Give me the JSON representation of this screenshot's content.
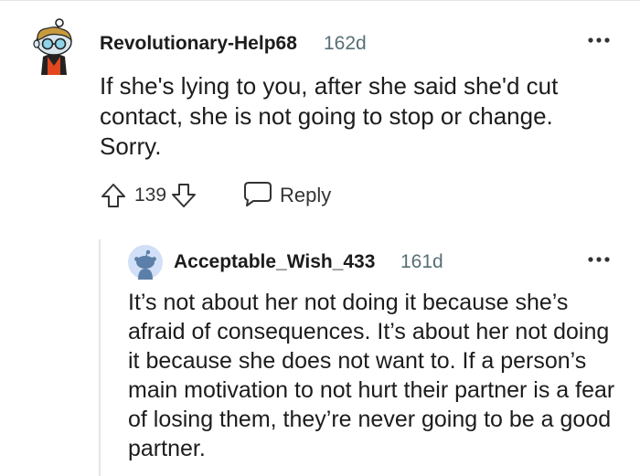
{
  "comment": {
    "author": "Revolutionary-Help68",
    "age": "162d",
    "body": "If she's lying to you, after she said she'd cut contact, she is not going to stop or change. Sorry.",
    "score": "139",
    "reply_label": "Reply",
    "icons": {
      "avatar": "snoo-avatar-icon",
      "more": "more-options-icon",
      "upvote": "upvote-arrow-icon",
      "downvote": "downvote-arrow-icon",
      "reply": "reply-bubble-icon"
    }
  },
  "reply": {
    "author": "Acceptable_Wish_433",
    "age": "161d",
    "body": "It’s not about her not doing it because she’s afraid of consequences. It’s about her not doing it because she does not want to. If a person’s main motivation to not hurt their partner is a fear of losing them, they’re never going to be a good partner.",
    "icons": {
      "avatar": "default-snoo-avatar-icon",
      "more": "more-options-icon"
    }
  },
  "colors": {
    "text": "#1c1c1c",
    "meta": "#576f76",
    "avatar_bg": "#d1dff7",
    "avatar_snoo": "#5b7fa8"
  }
}
